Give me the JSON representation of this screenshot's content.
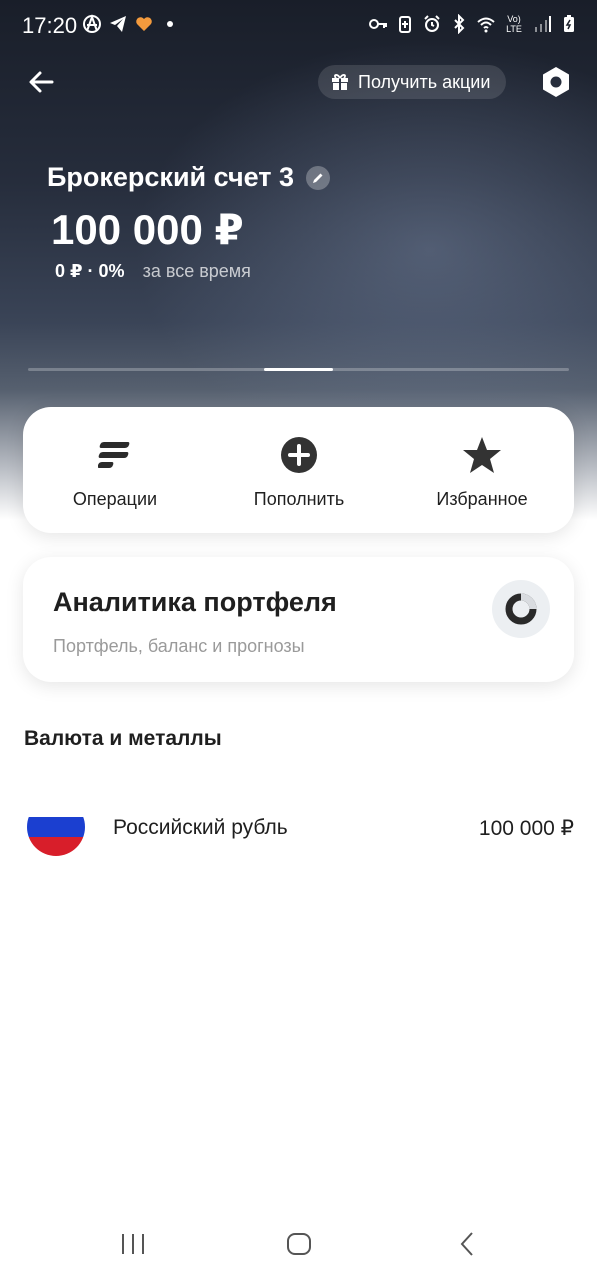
{
  "status_bar": {
    "time": "17:20",
    "left_icons": [
      "anarchy-icon",
      "telegram-icon",
      "heart-app-icon",
      "dot-icon"
    ],
    "right_icons": [
      "vpn-key-icon",
      "battery-saver-icon",
      "alarm-icon",
      "bluetooth-icon",
      "wifi-icon",
      "volte-icon",
      "signal-icon",
      "battery-icon"
    ],
    "volte_label": "Vo) LTE"
  },
  "header": {
    "back_icon": "arrow-left-icon",
    "promo_label": "Получить акции",
    "promo_icon": "gift-icon",
    "settings_icon": "settings-hex-icon"
  },
  "account": {
    "title": "Брокерский счет 3",
    "balance": "100 000 ₽",
    "change": "0 ₽ · 0%",
    "period": "за все время",
    "active_page_fraction": 0.5
  },
  "actions": [
    {
      "label": "Операции",
      "icon": "operations-icon"
    },
    {
      "label": "Пополнить",
      "icon": "plus-circle-icon"
    },
    {
      "label": "Избранное",
      "icon": "star-icon"
    }
  ],
  "analytics": {
    "title": "Аналитика портфеля",
    "subtitle": "Портфель, баланс и прогнозы",
    "icon": "donut-chart-icon"
  },
  "section": {
    "title": "Валюта и металлы"
  },
  "currencies": [
    {
      "name": "Российский рубль",
      "amount": "100 000 ₽",
      "flag_colors": [
        "#ffffff",
        "#1b3fd0",
        "#d81e2a"
      ]
    }
  ],
  "colors": {
    "hero_dark": "#191e29",
    "text_primary": "#1f1f1f",
    "text_secondary": "#9a9a9a"
  },
  "nav": [
    "recents-icon",
    "home-icon",
    "back-icon"
  ]
}
